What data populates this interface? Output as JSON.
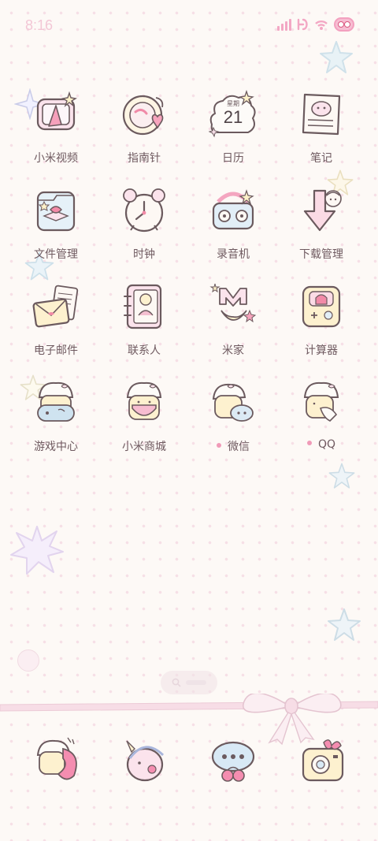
{
  "status_bar": {
    "time": "8:16",
    "icons": [
      "signal-icon",
      "hd-icon",
      "wifi-icon",
      "battery-icon"
    ],
    "battery_level_percent": 100
  },
  "apps": [
    {
      "label": "小米视频",
      "icon": "video-tv-icon",
      "dot": false
    },
    {
      "label": "指南针",
      "icon": "compass-heart-icon",
      "dot": false
    },
    {
      "label": "日历",
      "icon": "calendar-cloud-icon",
      "dot": false
    },
    {
      "label": "笔记",
      "icon": "notes-icon",
      "dot": false
    },
    {
      "label": "文件管理",
      "icon": "folder-bow-icon",
      "dot": false
    },
    {
      "label": "时钟",
      "icon": "alarm-clock-icon",
      "dot": false
    },
    {
      "label": "录音机",
      "icon": "recorder-icon",
      "dot": false
    },
    {
      "label": "下载管理",
      "icon": "download-arrow-icon",
      "dot": false
    },
    {
      "label": "电子邮件",
      "icon": "envelope-icon",
      "dot": false
    },
    {
      "label": "联系人",
      "icon": "contacts-book-icon",
      "dot": false
    },
    {
      "label": "米家",
      "icon": "mijia-moon-icon",
      "dot": false
    },
    {
      "label": "计算器",
      "icon": "calculator-icon",
      "dot": false
    },
    {
      "label": "游戏中心",
      "icon": "game-girl-icon",
      "dot": false
    },
    {
      "label": "小米商城",
      "icon": "shop-girl-icon",
      "dot": false
    },
    {
      "label": "微信",
      "icon": "wechat-girl-icon",
      "dot": true
    },
    {
      "label": "QQ",
      "icon": "qq-girl-icon",
      "dot": true
    }
  ],
  "calendar": {
    "weekday": "星期",
    "day": "21"
  },
  "dock": [
    "phone-girl-icon",
    "browser-unicorn-icon",
    "messages-cherry-icon",
    "camera-bow-icon"
  ],
  "colors": {
    "accent": "#f3a7c4",
    "label": "#6f5a60",
    "background": "#fdf9f6"
  }
}
